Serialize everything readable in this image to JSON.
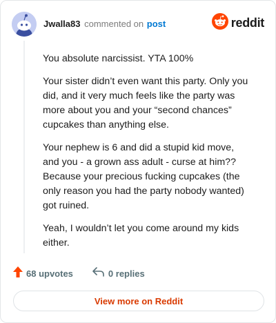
{
  "header": {
    "username": "Jwalla83",
    "action_text": "commented on",
    "post_link": "post",
    "brand_word": "reddit"
  },
  "comment": {
    "paragraphs": [
      "You absolute narcissist. YTA 100%",
      "Your sister didn’t even want this party. Only you did, and it very much feels like the party was more about you and your “second chances” cupcakes than anything else.",
      "Your nephew is 6 and did a stupid kid move, and you - a grown ass adult - curse at him?? Because your precious fucking cupcakes (the only reason you had the party nobody wanted) got ruined.",
      "Yeah, I wouldn’t let you come around my kids either."
    ]
  },
  "footer": {
    "upvotes_label": "68 upvotes",
    "replies_label": "0 replies",
    "view_more_label": "View more on Reddit"
  },
  "colors": {
    "upvote_arrow": "#ff4500",
    "brand_logo": "#ff4500",
    "link": "#0079d3",
    "view_more_text": "#d93a00"
  },
  "icons": [
    "snoo-avatar-icon",
    "reddit-logo-icon",
    "upvote-arrow-icon",
    "reply-arrow-icon"
  ]
}
